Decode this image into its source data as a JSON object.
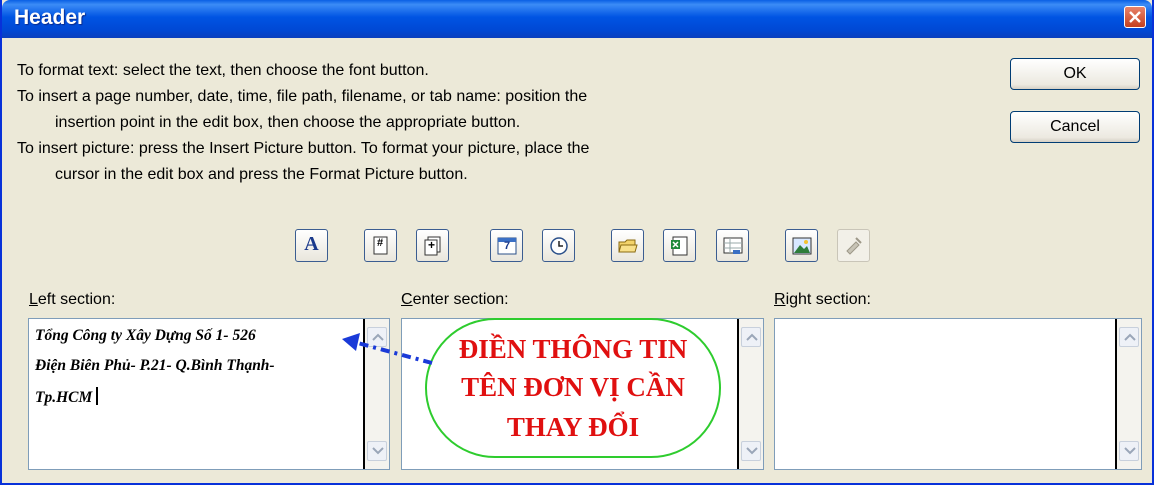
{
  "title": "Header",
  "instructions": [
    "To format text:  select the text, then choose the font button.",
    "To insert a page number, date, time, file path, filename, or tab name:  position the",
    "insertion point in the edit box, then choose the appropriate button.",
    "To insert picture: press the Insert Picture button.  To format your picture, place the",
    "cursor in the edit box and press the Format Picture button."
  ],
  "buttons": {
    "ok": "OK",
    "cancel": "Cancel"
  },
  "toolbar": {
    "font_glyph": "A",
    "page_number_glyph": "#",
    "total_pages_glyph": "+",
    "date_glyph": "7"
  },
  "sections": {
    "left": {
      "mnemonic": "L",
      "label_rest": "eft section:"
    },
    "center": {
      "mnemonic": "C",
      "label_rest": "enter section:"
    },
    "right": {
      "mnemonic": "R",
      "label_rest": "ight section:"
    }
  },
  "left_text": [
    "Tổng Công ty Xây Dựng Số 1- 526",
    "Điện Biên Phủ- P.21- Q.Bình Thạnh-",
    "Tp.HCM"
  ],
  "annotation": [
    "ĐIỀN THÔNG TIN",
    "TÊN ĐƠN VỊ CẦN",
    "THAY ĐỔI"
  ],
  "colors": {
    "annotation_text": "#e01010",
    "annotation_border": "#2ecc2e",
    "arrow": "#1a3ad8",
    "titlebar": "#0054e3"
  },
  "icons": [
    "font-icon",
    "page-number-icon",
    "total-pages-icon",
    "date-icon",
    "time-icon",
    "file-path-icon",
    "filename-icon",
    "sheet-name-icon",
    "insert-picture-icon",
    "format-picture-icon"
  ]
}
